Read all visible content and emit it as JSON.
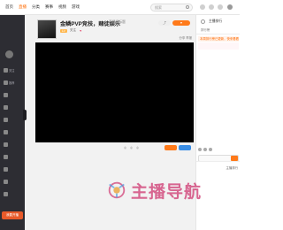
{
  "topnav": {
    "items": [
      "首页",
      "直播",
      "分类",
      "赛事",
      "视频",
      "游戏",
      ""
    ],
    "active_index": 1,
    "search_placeholder": "搜索"
  },
  "sidebar": {
    "labels": [
      "关注",
      "推荐",
      "",
      "",
      "",
      "",
      "",
      "",
      "",
      "",
      "",
      "",
      "",
      "",
      "",
      "",
      ""
    ],
    "bottom_button": "我要开播"
  },
  "stream": {
    "title": "金鳞PVP竞技，赌徒娱乐",
    "subtitle": "直播间标题",
    "badge": "",
    "meta": [
      "关注",
      "",
      ""
    ],
    "links": [
      "分享",
      "举报"
    ]
  },
  "under_video": {
    "items": [
      "",
      "",
      ""
    ],
    "orange_btn": "",
    "blue_btn": ""
  },
  "right_panel": {
    "tab": "主播排行",
    "sub": "排行榜",
    "notice": "本周排行榜已更新，快来看看吧",
    "footer": "主播排行"
  },
  "watermark": {
    "text": "主播导航"
  },
  "colors": {
    "accent": "#ff6a00",
    "sidebar_bg": "#2d2d33",
    "video_bg": "#000000",
    "watermark": "#d34d7f"
  }
}
